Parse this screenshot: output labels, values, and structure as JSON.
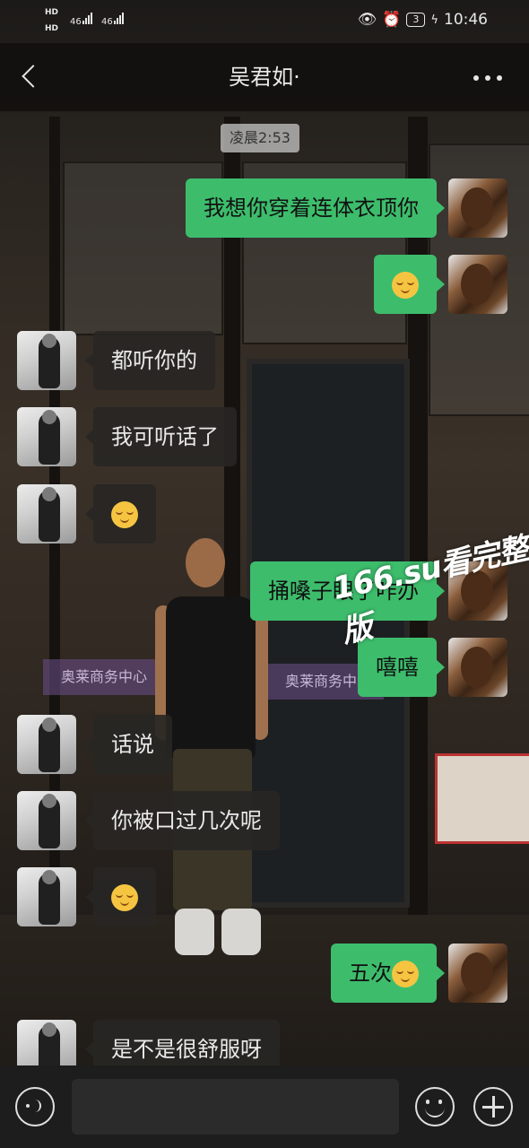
{
  "status_bar": {
    "sim1": "HD",
    "sim2": "HD",
    "net1": "46",
    "net2": "46",
    "battery": "3",
    "time": "10:46",
    "icons": [
      "eye-icon",
      "alarm-icon",
      "battery-icon",
      "charging-icon"
    ]
  },
  "header": {
    "title": "吴君如·"
  },
  "chat": {
    "timestamp": "凌晨2:53",
    "messages": [
      {
        "from": "me",
        "text": "我想你穿着连体衣顶你"
      },
      {
        "from": "me",
        "text": "",
        "emoji": "smirk-emoji"
      },
      {
        "from": "her",
        "text": "都听你的"
      },
      {
        "from": "her",
        "text": "我可听话了"
      },
      {
        "from": "her",
        "text": "",
        "emoji": "smirk-emoji"
      },
      {
        "from": "me",
        "text": "捅嗓子眼了咋办"
      },
      {
        "from": "me",
        "text": "嘻嘻"
      },
      {
        "from": "her",
        "text": "话说"
      },
      {
        "from": "her",
        "text": "你被口过几次呢"
      },
      {
        "from": "her",
        "text": "",
        "emoji": "smirk-emoji"
      },
      {
        "from": "me",
        "text": "五次",
        "emoji": "smirk-emoji"
      },
      {
        "from": "her",
        "text": "是不是很舒服呀"
      }
    ]
  },
  "watermark": "166.su看完整版",
  "background_signs": [
    "奥莱商务中心",
    "奥莱商务中心"
  ],
  "colors": {
    "outgoing_bubble": "#3dbd6c",
    "incoming_bubble": "#282624",
    "input_bar": "#1d1d1d"
  }
}
